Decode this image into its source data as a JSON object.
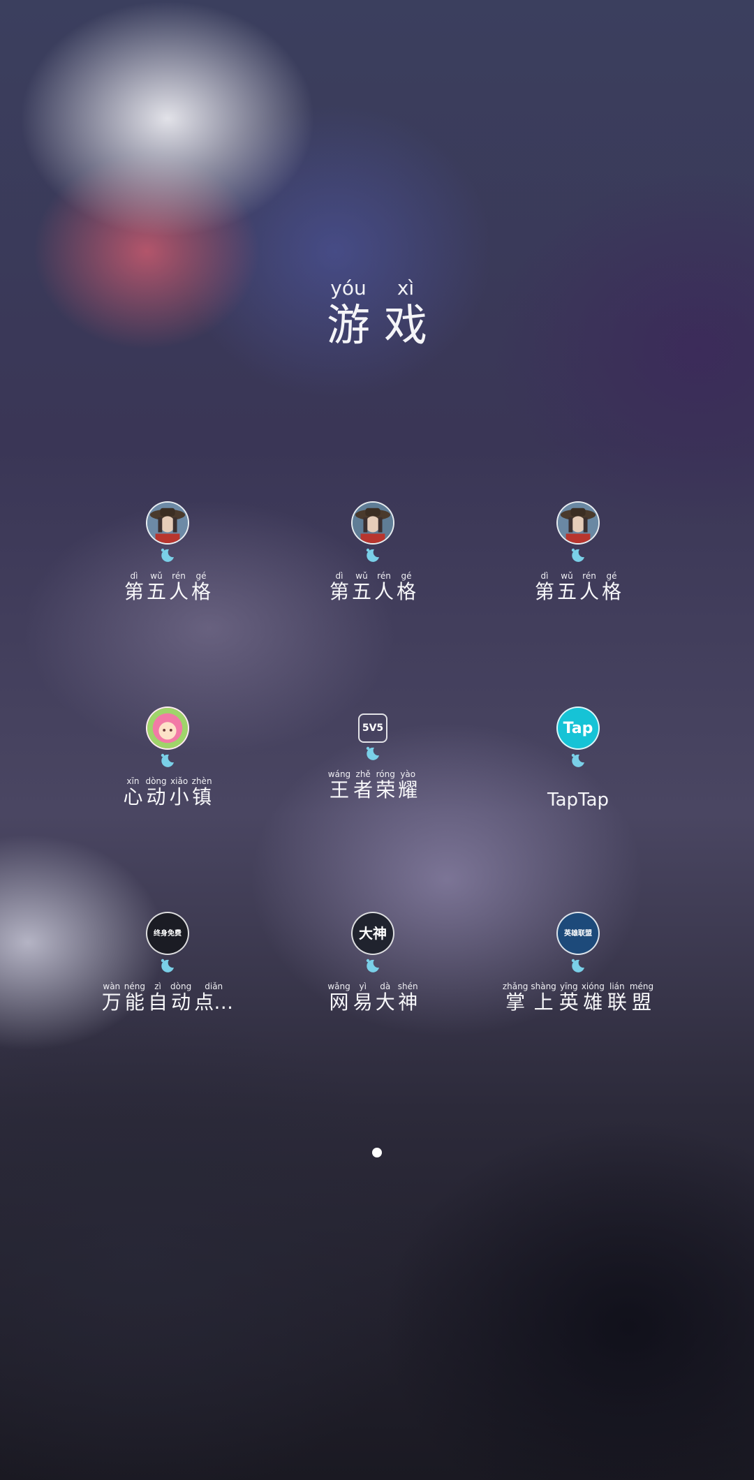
{
  "folder": {
    "title_chars": [
      {
        "pinyin": "yóu",
        "hanzi": "游"
      },
      {
        "pinyin": "xì",
        "hanzi": "戏"
      }
    ]
  },
  "apps": [
    {
      "name": "第五人格",
      "icon": "identity-v-avatar-icon",
      "icon_bg": "#6d8aa6",
      "chars": [
        {
          "p": "dì",
          "h": "第"
        },
        {
          "p": "wǔ",
          "h": "五"
        },
        {
          "p": "rén",
          "h": "人"
        },
        {
          "p": "gé",
          "h": "格"
        }
      ]
    },
    {
      "name": "第五人格",
      "icon": "identity-v-avatar-icon",
      "icon_bg": "#5f7d96",
      "chars": [
        {
          "p": "dì",
          "h": "第"
        },
        {
          "p": "wǔ",
          "h": "五"
        },
        {
          "p": "rén",
          "h": "人"
        },
        {
          "p": "gé",
          "h": "格"
        }
      ]
    },
    {
      "name": "第五人格",
      "icon": "identity-v-avatar-icon",
      "icon_bg": "#6a88a3",
      "chars": [
        {
          "p": "dì",
          "h": "第"
        },
        {
          "p": "wǔ",
          "h": "五"
        },
        {
          "p": "rén",
          "h": "人"
        },
        {
          "p": "gé",
          "h": "格"
        }
      ]
    },
    {
      "name": "心动小镇",
      "icon": "heartbeat-town-icon",
      "icon_bg": "#f27aa6",
      "chars": [
        {
          "p": "xīn",
          "h": "心"
        },
        {
          "p": "dòng",
          "h": "动"
        },
        {
          "p": "xiǎo",
          "h": "小"
        },
        {
          "p": "zhèn",
          "h": "镇"
        }
      ]
    },
    {
      "name": "王者荣耀",
      "icon": "5v5-icon",
      "icon_text": "5V5",
      "icon_bg": "transparent",
      "chars": [
        {
          "p": "wáng",
          "h": "王"
        },
        {
          "p": "zhě",
          "h": "者"
        },
        {
          "p": "róng",
          "h": "荣"
        },
        {
          "p": "yào",
          "h": "耀"
        }
      ]
    },
    {
      "name": "TapTap",
      "icon": "taptap-icon",
      "icon_text": "Tap",
      "icon_bg": "#16c3d6",
      "plain_label": "TapTap"
    },
    {
      "name": "万能自动点…",
      "icon": "auto-clicker-icon",
      "icon_text": "终身免费",
      "icon_bg": "#1b1c24",
      "chars": [
        {
          "p": "wàn",
          "h": "万"
        },
        {
          "p": "néng",
          "h": "能"
        },
        {
          "p": "zì",
          "h": "自"
        },
        {
          "p": "dòng",
          "h": "动"
        },
        {
          "p": "diǎn",
          "h": "点…"
        }
      ]
    },
    {
      "name": "网易大神",
      "icon": "netease-dashen-icon",
      "icon_text": "大神",
      "icon_bg": "#20232e",
      "chars": [
        {
          "p": "wǎng",
          "h": "网"
        },
        {
          "p": "yì",
          "h": "易"
        },
        {
          "p": "dà",
          "h": "大"
        },
        {
          "p": "shén",
          "h": "神"
        }
      ]
    },
    {
      "name": "掌上英雄联盟",
      "icon": "lol-pocket-icon",
      "icon_text": "英雄联盟",
      "icon_bg": "#1d4a7a",
      "chars": [
        {
          "p": "zhǎng",
          "h": "掌"
        },
        {
          "p": "shàng",
          "h": "上"
        },
        {
          "p": "yīng",
          "h": "英"
        },
        {
          "p": "xióng",
          "h": "雄"
        },
        {
          "p": "lián",
          "h": "联"
        },
        {
          "p": "méng",
          "h": "盟"
        }
      ]
    }
  ],
  "status_indicator_icon": "moon-sleep-icon",
  "page_indicator": {
    "current": 1,
    "total": 1
  }
}
